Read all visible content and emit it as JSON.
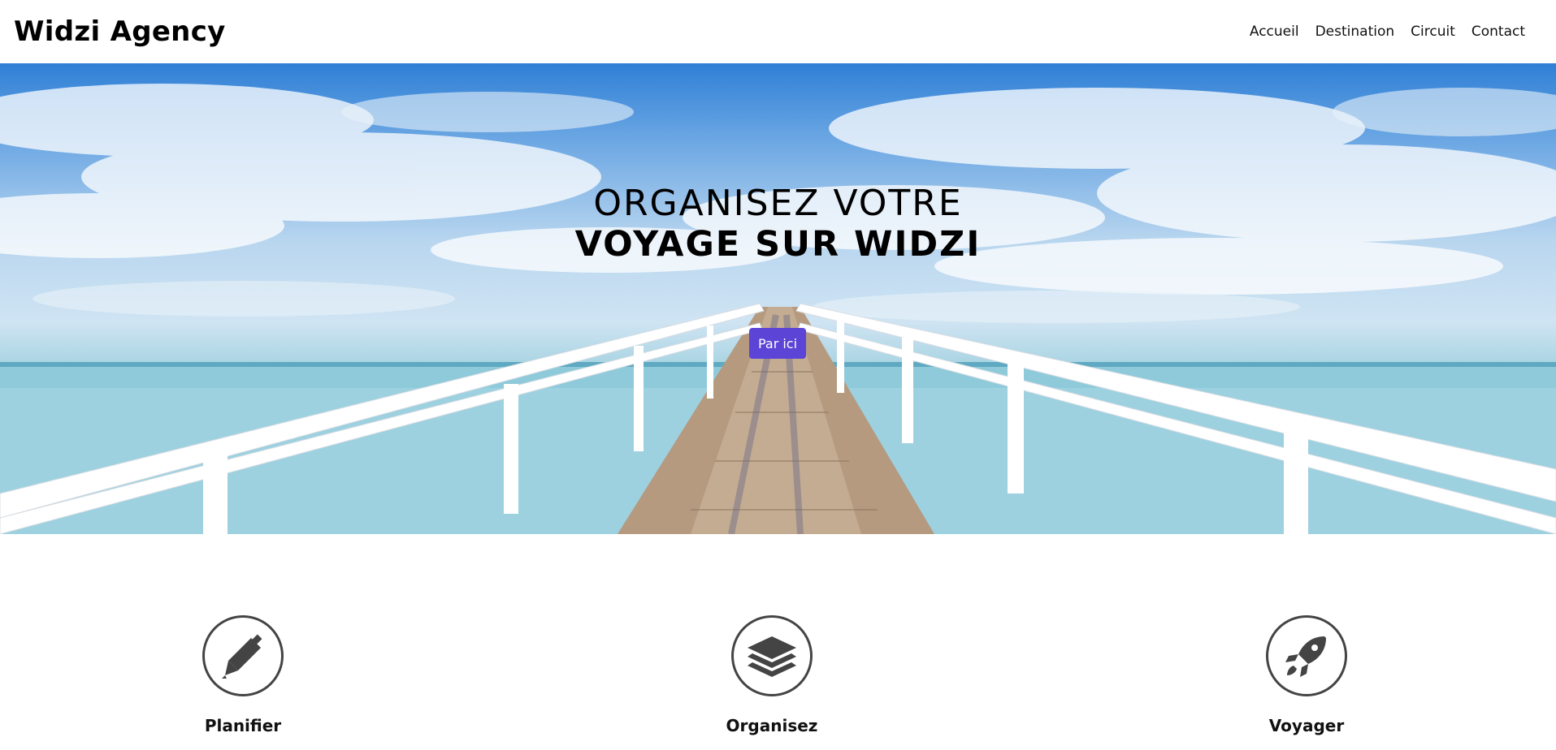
{
  "navbar": {
    "brand": "Widzi Agency",
    "links": [
      "Accueil",
      "Destination",
      "Circuit",
      "Contact"
    ]
  },
  "hero": {
    "line1": "ORGANISEZ VOTRE",
    "line2": "VOYAGE SUR WIDZI",
    "button_label": "Par ici",
    "accent_color": "#5b44d6"
  },
  "features": [
    {
      "label": "Planifier",
      "icon": "pen-icon"
    },
    {
      "label": "Organisez",
      "icon": "layers-icon"
    },
    {
      "label": "Voyager",
      "icon": "rocket-icon"
    }
  ]
}
